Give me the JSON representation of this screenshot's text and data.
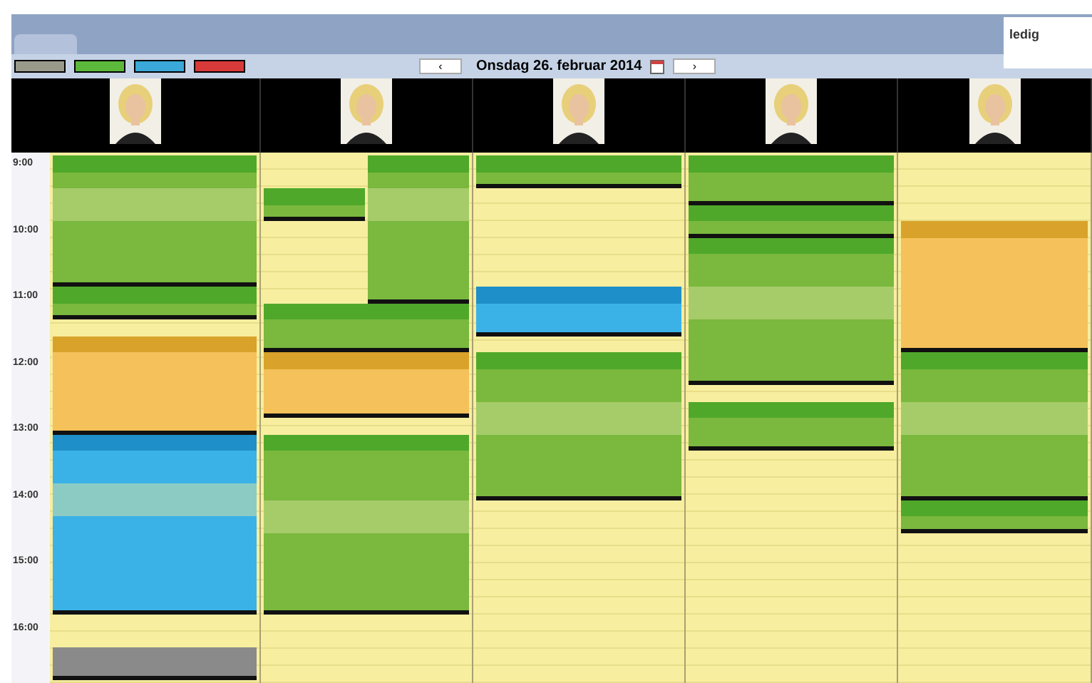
{
  "date_nav": {
    "prev": "‹",
    "date": "Onsdag 26. februar 2014",
    "next": "›"
  },
  "logo": {
    "text": "ledig"
  },
  "legend": [
    {
      "color": "#9a9a8a"
    },
    {
      "color": "#5cb83a"
    },
    {
      "color": "#3aa8d8"
    },
    {
      "color": "#d83a3a"
    }
  ],
  "staff": [
    {
      "kind": "picture"
    },
    {
      "kind": "picture"
    },
    {
      "kind": "picture"
    },
    {
      "kind": "picture"
    },
    {
      "kind": "picture"
    }
  ],
  "times": [
    "9:00",
    "10:00",
    "11:00",
    "12:00",
    "13:00",
    "14:00",
    "15:00",
    "16:00"
  ],
  "columns": [
    {
      "blocks": [
        {
          "kind": "booking",
          "slots": [
            {
              "kind": "head"
            },
            {
              "kind": "body"
            },
            {
              "kind": "band"
            },
            {
              "kind": "band"
            },
            {
              "kind": "body"
            },
            {
              "kind": "body"
            },
            {
              "kind": "body"
            },
            {
              "kind": "body"
            }
          ]
        },
        {
          "kind": "booking",
          "slots": [
            {
              "kind": "head"
            },
            {
              "kind": "body"
            }
          ]
        },
        {
          "kind": "free",
          "slots": [
            {
              "kind": "empty"
            }
          ]
        },
        {
          "kind": "break",
          "slots": [
            {
              "kind": "head"
            },
            {
              "kind": "body"
            },
            {
              "kind": "body"
            },
            {
              "kind": "body"
            },
            {
              "kind": "body"
            },
            {
              "kind": "body"
            }
          ]
        },
        {
          "kind": "other",
          "slots": [
            {
              "kind": "head"
            },
            {
              "kind": "body"
            },
            {
              "kind": "body"
            },
            {
              "kind": "band"
            },
            {
              "kind": "band"
            },
            {
              "kind": "body"
            },
            {
              "kind": "body"
            },
            {
              "kind": "body"
            },
            {
              "kind": "body"
            },
            {
              "kind": "body"
            },
            {
              "kind": "body"
            }
          ]
        },
        {
          "kind": "free",
          "slots": [
            {
              "kind": "empty"
            },
            {
              "kind": "empty"
            }
          ]
        },
        {
          "kind": "blocked",
          "slots": [
            {
              "kind": "body"
            },
            {
              "kind": "body"
            }
          ]
        }
      ]
    },
    {
      "blocks": [
        {
          "kind": "split",
          "lanes": [
            [
              {
                "kind": "free",
                "slots": [
                  {
                    "kind": "empty"
                  },
                  {
                    "kind": "empty"
                  }
                ]
              },
              {
                "kind": "booking",
                "slots": [
                  {
                    "kind": "head"
                  },
                  {
                    "kind": "body"
                  }
                ]
              }
            ],
            [
              {
                "kind": "booking",
                "slots": [
                  {
                    "kind": "head"
                  },
                  {
                    "kind": "body"
                  },
                  {
                    "kind": "band"
                  },
                  {
                    "kind": "band"
                  },
                  {
                    "kind": "body"
                  },
                  {
                    "kind": "body"
                  },
                  {
                    "kind": "body"
                  },
                  {
                    "kind": "body"
                  },
                  {
                    "kind": "body"
                  }
                ]
              }
            ]
          ]
        },
        {
          "kind": "booking",
          "slots": [
            {
              "kind": "head"
            },
            {
              "kind": "body"
            },
            {
              "kind": "body"
            }
          ]
        },
        {
          "kind": "break",
          "slots": [
            {
              "kind": "head"
            },
            {
              "kind": "body"
            },
            {
              "kind": "body"
            },
            {
              "kind": "body"
            }
          ]
        },
        {
          "kind": "free",
          "slots": [
            {
              "kind": "empty"
            }
          ]
        },
        {
          "kind": "booking",
          "slots": [
            {
              "kind": "head"
            },
            {
              "kind": "body"
            },
            {
              "kind": "body"
            },
            {
              "kind": "body"
            },
            {
              "kind": "band"
            },
            {
              "kind": "band"
            },
            {
              "kind": "body"
            },
            {
              "kind": "body"
            },
            {
              "kind": "body"
            },
            {
              "kind": "body"
            },
            {
              "kind": "body"
            }
          ]
        }
      ]
    },
    {
      "blocks": [
        {
          "kind": "booking",
          "slots": [
            {
              "kind": "head"
            },
            {
              "kind": "body"
            }
          ]
        },
        {
          "kind": "free",
          "slots": [
            {
              "kind": "empty"
            },
            {
              "kind": "empty"
            },
            {
              "kind": "empty"
            },
            {
              "kind": "empty"
            },
            {
              "kind": "empty"
            },
            {
              "kind": "empty"
            }
          ]
        },
        {
          "kind": "other",
          "slots": [
            {
              "kind": "head"
            },
            {
              "kind": "body"
            },
            {
              "kind": "body"
            }
          ]
        },
        {
          "kind": "free",
          "slots": [
            {
              "kind": "empty"
            }
          ]
        },
        {
          "kind": "booking",
          "slots": [
            {
              "kind": "head"
            },
            {
              "kind": "body"
            },
            {
              "kind": "body"
            },
            {
              "kind": "band"
            },
            {
              "kind": "band"
            },
            {
              "kind": "body"
            },
            {
              "kind": "body"
            },
            {
              "kind": "body"
            },
            {
              "kind": "body"
            }
          ]
        }
      ]
    },
    {
      "blocks": [
        {
          "kind": "booking",
          "slots": [
            {
              "kind": "head"
            },
            {
              "kind": "body"
            },
            {
              "kind": "body"
            }
          ]
        },
        {
          "kind": "booking",
          "slots": [
            {
              "kind": "head"
            },
            {
              "kind": "body"
            }
          ]
        },
        {
          "kind": "booking",
          "slots": [
            {
              "kind": "head"
            },
            {
              "kind": "body"
            },
            {
              "kind": "body"
            },
            {
              "kind": "band"
            },
            {
              "kind": "band"
            },
            {
              "kind": "body"
            },
            {
              "kind": "body"
            },
            {
              "kind": "body"
            },
            {
              "kind": "body"
            }
          ]
        },
        {
          "kind": "free",
          "slots": [
            {
              "kind": "empty"
            }
          ]
        },
        {
          "kind": "booking",
          "slots": [
            {
              "kind": "head"
            },
            {
              "kind": "body"
            },
            {
              "kind": "body"
            }
          ]
        }
      ]
    },
    {
      "blocks": [
        {
          "kind": "free",
          "slots": [
            {
              "kind": "empty"
            },
            {
              "kind": "empty"
            },
            {
              "kind": "empty"
            },
            {
              "kind": "empty"
            }
          ]
        },
        {
          "kind": "break",
          "slots": [
            {
              "kind": "head"
            },
            {
              "kind": "body"
            },
            {
              "kind": "body"
            },
            {
              "kind": "body"
            },
            {
              "kind": "body"
            },
            {
              "kind": "body"
            },
            {
              "kind": "body"
            },
            {
              "kind": "body"
            }
          ]
        },
        {
          "kind": "booking",
          "slots": [
            {
              "kind": "head"
            },
            {
              "kind": "body"
            },
            {
              "kind": "body"
            },
            {
              "kind": "band"
            },
            {
              "kind": "band"
            },
            {
              "kind": "body"
            },
            {
              "kind": "body"
            },
            {
              "kind": "body"
            },
            {
              "kind": "body"
            }
          ]
        },
        {
          "kind": "booking",
          "slots": [
            {
              "kind": "head"
            },
            {
              "kind": "body"
            }
          ]
        }
      ]
    }
  ]
}
